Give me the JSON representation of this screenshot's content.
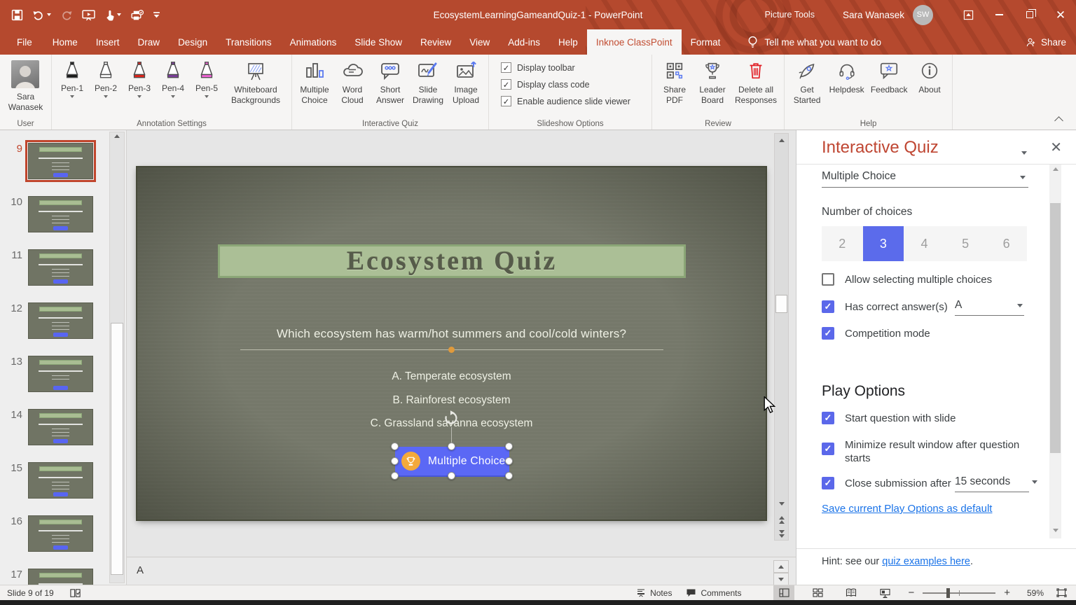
{
  "colors": {
    "accent_red": "#b5492e",
    "active_tab_text": "#c24e33",
    "classpoint_blue": "#5b68ea",
    "slide_button_blue": "#5865f2",
    "segment_selected_blue": "#5b6beb",
    "link_blue": "#1a73e8",
    "trophy_gold": "#f3a93c",
    "slide_banner_green": "#abbf96",
    "slide_bg_olive": "#75786a",
    "selected_thumb_border": "#c0452c"
  },
  "titlebar": {
    "title": "EcosystemLearningGameandQuiz-1  -  PowerPoint",
    "contextual_tab": "Picture Tools",
    "user_name": "Sara Wanasek",
    "user_initials": "SW",
    "qat_icons": [
      "save",
      "undo",
      "redo",
      "start-slideshow",
      "touch-mode",
      "quick-print",
      "customize-qat"
    ]
  },
  "tabs": [
    {
      "label": "File",
      "active": false
    },
    {
      "label": "Home",
      "active": false
    },
    {
      "label": "Insert",
      "active": false
    },
    {
      "label": "Draw",
      "active": false
    },
    {
      "label": "Design",
      "active": false
    },
    {
      "label": "Transitions",
      "active": false
    },
    {
      "label": "Animations",
      "active": false
    },
    {
      "label": "Slide Show",
      "active": false
    },
    {
      "label": "Review",
      "active": false
    },
    {
      "label": "View",
      "active": false
    },
    {
      "label": "Add-ins",
      "active": false
    },
    {
      "label": "Help",
      "active": false
    },
    {
      "label": "Inknoe ClassPoint",
      "active": true
    },
    {
      "label": "Format",
      "active": false
    }
  ],
  "tellme": {
    "label": "Tell me what you want to do"
  },
  "share": {
    "label": "Share"
  },
  "ribbon": {
    "user": {
      "caption": "User",
      "name_line1": "Sara",
      "name_line2": "Wanasek"
    },
    "annotation": {
      "caption": "Annotation Settings",
      "pens": [
        {
          "label": "Pen-1",
          "color": "#1a1a1a"
        },
        {
          "label": "Pen-2",
          "color": "#ffffff"
        },
        {
          "label": "Pen-3",
          "color": "#e2231a"
        },
        {
          "label": "Pen-4",
          "color": "#7e3f9d"
        },
        {
          "label": "Pen-5",
          "color": "#f466d9"
        }
      ],
      "whiteboard": {
        "line1": "Whiteboard",
        "line2": "Backgrounds"
      }
    },
    "quiz": {
      "caption": "Interactive Quiz",
      "items": [
        {
          "line1": "Multiple",
          "line2": "Choice",
          "icon": "bar-chart"
        },
        {
          "line1": "Word",
          "line2": "Cloud",
          "icon": "word-cloud"
        },
        {
          "line1": "Short",
          "line2": "Answer",
          "icon": "speech-dots"
        },
        {
          "line1": "Slide",
          "line2": "Drawing",
          "icon": "pencil-canvas"
        },
        {
          "line1": "Image",
          "line2": "Upload",
          "icon": "image-upload"
        }
      ]
    },
    "slideshow_options": {
      "caption": "Slideshow Options",
      "checkboxes": [
        {
          "label": "Display toolbar",
          "checked": true
        },
        {
          "label": "Display class code",
          "checked": true
        },
        {
          "label": "Enable audience slide viewer",
          "checked": true
        }
      ]
    },
    "review": {
      "caption": "Review",
      "items": [
        {
          "line1": "Share",
          "line2": "PDF",
          "icon": "qr-code"
        },
        {
          "line1": "Leader",
          "line2": "Board",
          "icon": "trophy"
        },
        {
          "line1": "Delete all",
          "line2": "Responses",
          "icon": "trash"
        }
      ]
    },
    "help": {
      "caption": "Help",
      "items": [
        {
          "line1": "Get",
          "line2": "Started",
          "icon": "rocket"
        },
        {
          "line1": "Helpdesk",
          "line2": "",
          "icon": "headset"
        },
        {
          "line1": "Feedback",
          "line2": "",
          "icon": "feedback-bubble"
        },
        {
          "line1": "About",
          "line2": "",
          "icon": "info-circle"
        }
      ]
    }
  },
  "thumbnails": {
    "slides": [
      {
        "num": "9",
        "selected": true
      },
      {
        "num": "10",
        "selected": false
      },
      {
        "num": "11",
        "selected": false
      },
      {
        "num": "12",
        "selected": false
      },
      {
        "num": "13",
        "selected": false
      },
      {
        "num": "14",
        "selected": false
      },
      {
        "num": "15",
        "selected": false
      },
      {
        "num": "16",
        "selected": false
      },
      {
        "num": "17",
        "selected": false
      }
    ]
  },
  "slide": {
    "title": "Ecosystem Quiz",
    "question": "Which ecosystem has warm/hot summers and cool/cold winters?",
    "options": [
      "A. Temperate ecosystem",
      "B. Rainforest ecosystem",
      "C. Grassland savanna ecosystem"
    ],
    "button_label": "Multiple Choice"
  },
  "notes": {
    "text": "A"
  },
  "panel": {
    "title": "Interactive Quiz",
    "type_selector": {
      "value": "Multiple Choice"
    },
    "number_of_choices": {
      "label": "Number of choices",
      "options": [
        "2",
        "3",
        "4",
        "5",
        "6"
      ],
      "selected": [
        false,
        true,
        false,
        false,
        false
      ]
    },
    "checkboxes": [
      {
        "label": "Allow selecting multiple choices",
        "checked": false
      },
      {
        "label": "Has correct answer(s)",
        "checked": true,
        "value": "A"
      },
      {
        "label": "Competition mode",
        "checked": true
      }
    ],
    "play_options": {
      "heading": "Play Options",
      "items": [
        {
          "label": "Start question with slide",
          "checked": true
        },
        {
          "label": "Minimize result window after question starts",
          "checked": true
        },
        {
          "label": "Close submission after",
          "checked": true,
          "value": "15 seconds"
        }
      ],
      "save_default_link": "Save current Play Options as default"
    },
    "hint": {
      "prefix": "Hint: see our ",
      "link": "quiz examples here",
      "suffix": "."
    }
  },
  "statusbar": {
    "slide_indicator": "Slide 9 of 19",
    "notes_label": "Notes",
    "comments_label": "Comments",
    "zoom_level": "59%"
  }
}
